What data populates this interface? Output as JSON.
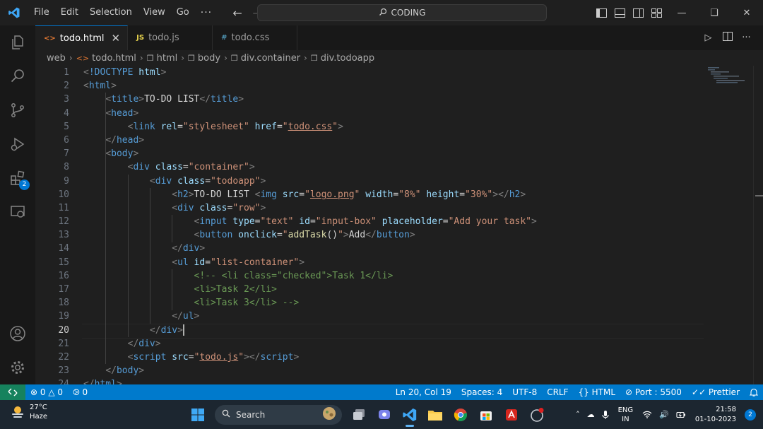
{
  "menu": [
    "File",
    "Edit",
    "Selection",
    "View",
    "Go"
  ],
  "menu_more": "···",
  "command_center": {
    "label": "CODING"
  },
  "tabs": [
    {
      "label": "todo.html",
      "icon": "<>",
      "active": true
    },
    {
      "label": "todo.js",
      "icon": "JS",
      "active": false
    },
    {
      "label": "todo.css",
      "icon": "#",
      "active": false
    }
  ],
  "breadcrumbs": [
    "web",
    "todo.html",
    "html",
    "body",
    "div.container",
    "div.todoapp"
  ],
  "activity": {
    "extensions_badge": "2"
  },
  "editor": {
    "current_line": 20,
    "line_numbers": [
      "1",
      "2",
      "3",
      "4",
      "5",
      "6",
      "7",
      "8",
      "9",
      "10",
      "11",
      "12",
      "13",
      "14",
      "15",
      "16",
      "17",
      "18",
      "19",
      "20",
      "21",
      "22",
      "23",
      "24"
    ],
    "lines": [
      [
        [
          "br",
          "<"
        ],
        [
          "tag",
          "!DOCTYPE"
        ],
        [
          "txt",
          " "
        ],
        [
          "attr",
          "html"
        ],
        [
          "br",
          ">"
        ]
      ],
      [
        [
          "br",
          "<"
        ],
        [
          "tag",
          "html"
        ],
        [
          "br",
          ">"
        ]
      ],
      [
        [
          "txt",
          "    "
        ],
        [
          "br",
          "<"
        ],
        [
          "tag",
          "title"
        ],
        [
          "br",
          ">"
        ],
        [
          "txt",
          "TO-DO LIST"
        ],
        [
          "br",
          "</"
        ],
        [
          "tag",
          "title"
        ],
        [
          "br",
          ">"
        ]
      ],
      [
        [
          "txt",
          "    "
        ],
        [
          "br",
          "<"
        ],
        [
          "tag",
          "head"
        ],
        [
          "br",
          ">"
        ]
      ],
      [
        [
          "txt",
          "        "
        ],
        [
          "br",
          "<"
        ],
        [
          "tag",
          "link"
        ],
        [
          "txt",
          " "
        ],
        [
          "attr",
          "rel"
        ],
        [
          "txt",
          "="
        ],
        [
          "str",
          "\"stylesheet\""
        ],
        [
          "txt",
          " "
        ],
        [
          "attr",
          "href"
        ],
        [
          "txt",
          "="
        ],
        [
          "str",
          "\""
        ],
        [
          "link",
          "todo.css"
        ],
        [
          "str",
          "\""
        ],
        [
          "br",
          ">"
        ]
      ],
      [
        [
          "txt",
          "    "
        ],
        [
          "br",
          "</"
        ],
        [
          "tag",
          "head"
        ],
        [
          "br",
          ">"
        ]
      ],
      [
        [
          "txt",
          "    "
        ],
        [
          "br",
          "<"
        ],
        [
          "tag",
          "body"
        ],
        [
          "br",
          ">"
        ]
      ],
      [
        [
          "txt",
          "        "
        ],
        [
          "br",
          "<"
        ],
        [
          "tag",
          "div"
        ],
        [
          "txt",
          " "
        ],
        [
          "attr",
          "class"
        ],
        [
          "txt",
          "="
        ],
        [
          "str",
          "\"container\""
        ],
        [
          "br",
          ">"
        ]
      ],
      [
        [
          "txt",
          "            "
        ],
        [
          "br",
          "<"
        ],
        [
          "tag",
          "div"
        ],
        [
          "txt",
          " "
        ],
        [
          "attr",
          "class"
        ],
        [
          "txt",
          "="
        ],
        [
          "str",
          "\"todoapp\""
        ],
        [
          "br",
          ">"
        ]
      ],
      [
        [
          "txt",
          "                "
        ],
        [
          "br",
          "<"
        ],
        [
          "tag",
          "h2"
        ],
        [
          "br",
          ">"
        ],
        [
          "txt",
          "TO-DO LIST "
        ],
        [
          "br",
          "<"
        ],
        [
          "tag",
          "img"
        ],
        [
          "txt",
          " "
        ],
        [
          "attr",
          "src"
        ],
        [
          "txt",
          "="
        ],
        [
          "str",
          "\""
        ],
        [
          "link",
          "logo.png"
        ],
        [
          "str",
          "\""
        ],
        [
          "txt",
          " "
        ],
        [
          "attr",
          "width"
        ],
        [
          "txt",
          "="
        ],
        [
          "str",
          "\"8%\""
        ],
        [
          "txt",
          " "
        ],
        [
          "attr",
          "height"
        ],
        [
          "txt",
          "="
        ],
        [
          "str",
          "\"30%\""
        ],
        [
          "br",
          "></"
        ],
        [
          "tag",
          "h2"
        ],
        [
          "br",
          ">"
        ]
      ],
      [
        [
          "txt",
          "                "
        ],
        [
          "br",
          "<"
        ],
        [
          "tag",
          "div"
        ],
        [
          "txt",
          " "
        ],
        [
          "attr",
          "class"
        ],
        [
          "txt",
          "="
        ],
        [
          "str",
          "\"row\""
        ],
        [
          "br",
          ">"
        ]
      ],
      [
        [
          "txt",
          "                    "
        ],
        [
          "br",
          "<"
        ],
        [
          "tag",
          "input"
        ],
        [
          "txt",
          " "
        ],
        [
          "attr",
          "type"
        ],
        [
          "txt",
          "="
        ],
        [
          "str",
          "\"text\""
        ],
        [
          "txt",
          " "
        ],
        [
          "attr",
          "id"
        ],
        [
          "txt",
          "="
        ],
        [
          "str",
          "\"input-box\""
        ],
        [
          "txt",
          " "
        ],
        [
          "attr",
          "placeholder"
        ],
        [
          "txt",
          "="
        ],
        [
          "str",
          "\"Add your task\""
        ],
        [
          "br",
          ">"
        ]
      ],
      [
        [
          "txt",
          "                    "
        ],
        [
          "br",
          "<"
        ],
        [
          "tag",
          "button"
        ],
        [
          "txt",
          " "
        ],
        [
          "attr",
          "onclick"
        ],
        [
          "txt",
          "="
        ],
        [
          "str",
          "\""
        ],
        [
          "fn",
          "addTask"
        ],
        [
          "txt",
          "()"
        ],
        [
          "str",
          "\""
        ],
        [
          "br",
          ">"
        ],
        [
          "txt",
          "Add"
        ],
        [
          "br",
          "</"
        ],
        [
          "tag",
          "button"
        ],
        [
          "br",
          ">"
        ]
      ],
      [
        [
          "txt",
          "                "
        ],
        [
          "br",
          "</"
        ],
        [
          "tag",
          "div"
        ],
        [
          "br",
          ">"
        ]
      ],
      [
        [
          "txt",
          "                "
        ],
        [
          "br",
          "<"
        ],
        [
          "tag",
          "ul"
        ],
        [
          "txt",
          " "
        ],
        [
          "attr",
          "id"
        ],
        [
          "txt",
          "="
        ],
        [
          "str",
          "\"list-container\""
        ],
        [
          "br",
          ">"
        ]
      ],
      [
        [
          "txt",
          "                    "
        ],
        [
          "com",
          "<!-- <li class=\"checked\">Task 1</li>"
        ]
      ],
      [
        [
          "txt",
          "                    "
        ],
        [
          "com",
          "<li>Task 2</li>"
        ]
      ],
      [
        [
          "txt",
          "                    "
        ],
        [
          "com",
          "<li>Task 3</li> -->"
        ]
      ],
      [
        [
          "txt",
          "                "
        ],
        [
          "br",
          "</"
        ],
        [
          "tag",
          "ul"
        ],
        [
          "br",
          ">"
        ]
      ],
      [
        [
          "txt",
          "            "
        ],
        [
          "br",
          "</"
        ],
        [
          "tag",
          "div"
        ],
        [
          "br",
          ">"
        ]
      ],
      [
        [
          "txt",
          "        "
        ],
        [
          "br",
          "</"
        ],
        [
          "tag",
          "div"
        ],
        [
          "br",
          ">"
        ]
      ],
      [
        [
          "txt",
          "        "
        ],
        [
          "br",
          "<"
        ],
        [
          "tag",
          "script"
        ],
        [
          "txt",
          " "
        ],
        [
          "attr",
          "src"
        ],
        [
          "txt",
          "="
        ],
        [
          "str",
          "\""
        ],
        [
          "link",
          "todo.js"
        ],
        [
          "str",
          "\""
        ],
        [
          "br",
          "></"
        ],
        [
          "tag",
          "script"
        ],
        [
          "br",
          ">"
        ]
      ],
      [
        [
          "txt",
          "    "
        ],
        [
          "br",
          "</"
        ],
        [
          "tag",
          "body"
        ],
        [
          "br",
          ">"
        ]
      ],
      [
        [
          "br",
          "</"
        ],
        [
          "tag",
          "html"
        ],
        [
          "br",
          ">"
        ]
      ]
    ]
  },
  "status": {
    "errors": "0",
    "warnings": "0",
    "ports": "0",
    "position": "Ln 20, Col 19",
    "spaces": "Spaces: 4",
    "encoding": "UTF-8",
    "eol": "CRLF",
    "language": "HTML",
    "port": "Port : 5500",
    "prettier": "Prettier"
  },
  "taskbar": {
    "temp": "27°C",
    "condition": "Haze",
    "search": "Search",
    "lang1": "ENG",
    "lang2": "IN",
    "time": "21:58",
    "date": "01-10-2023",
    "notifications": "2"
  },
  "colors": {
    "accent": "#007acc",
    "remote": "#16825d",
    "tag": "#569cd6",
    "attr": "#9cdcfe",
    "string": "#ce9178",
    "comment": "#6a9955"
  }
}
